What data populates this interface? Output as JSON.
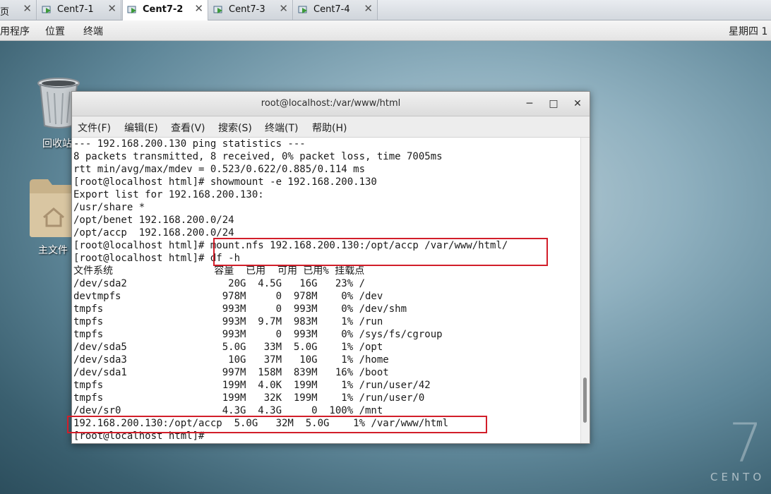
{
  "vm_tabs": [
    {
      "label": "页",
      "active": false
    },
    {
      "label": "Cent7-1",
      "active": false
    },
    {
      "label": "Cent7-2",
      "active": true
    },
    {
      "label": "Cent7-3",
      "active": false
    },
    {
      "label": "Cent7-4",
      "active": false
    }
  ],
  "topbar": {
    "menus": [
      "用程序",
      "位置",
      "终端"
    ],
    "clock": "星期四 1"
  },
  "desktop": {
    "trash_label": "回收站",
    "home_label": "主文件",
    "watermark_digit": "7",
    "watermark_word": "CENTO"
  },
  "terminal": {
    "title": "root@localhost:/var/www/html",
    "menus": [
      "文件(F)",
      "编辑(E)",
      "查看(V)",
      "搜索(S)",
      "终端(T)",
      "帮助(H)"
    ],
    "lines": [
      "--- 192.168.200.130 ping statistics ---",
      "8 packets transmitted, 8 received, 0% packet loss, time 7005ms",
      "rtt min/avg/max/mdev = 0.523/0.622/0.885/0.114 ms",
      "[root@localhost html]# showmount -e 192.168.200.130",
      "Export list for 192.168.200.130:",
      "/usr/share *",
      "/opt/benet 192.168.200.0/24",
      "/opt/accp  192.168.200.0/24",
      "[root@localhost html]# mount.nfs 192.168.200.130:/opt/accp /var/www/html/",
      "[root@localhost html]# df -h",
      "文件系统                 容量  已用  可用 已用% 挂载点",
      "/dev/sda2                 20G  4.5G   16G   23% /",
      "devtmpfs                 978M     0  978M    0% /dev",
      "tmpfs                    993M     0  993M    0% /dev/shm",
      "tmpfs                    993M  9.7M  983M    1% /run",
      "tmpfs                    993M     0  993M    0% /sys/fs/cgroup",
      "/dev/sda5                5.0G   33M  5.0G    1% /opt",
      "/dev/sda3                 10G   37M   10G    1% /home",
      "/dev/sda1                997M  158M  839M   16% /boot",
      "tmpfs                    199M  4.0K  199M    1% /run/user/42",
      "tmpfs                    199M   32K  199M    1% /run/user/0",
      "/dev/sr0                 4.3G  4.3G     0  100% /mnt",
      "192.168.200.130:/opt/accp  5.0G   32M  5.0G    1% /var/www/html",
      "[root@localhost html]# "
    ],
    "scroll_position": 0.92
  },
  "colors": {
    "highlight": "#d21e2a"
  }
}
